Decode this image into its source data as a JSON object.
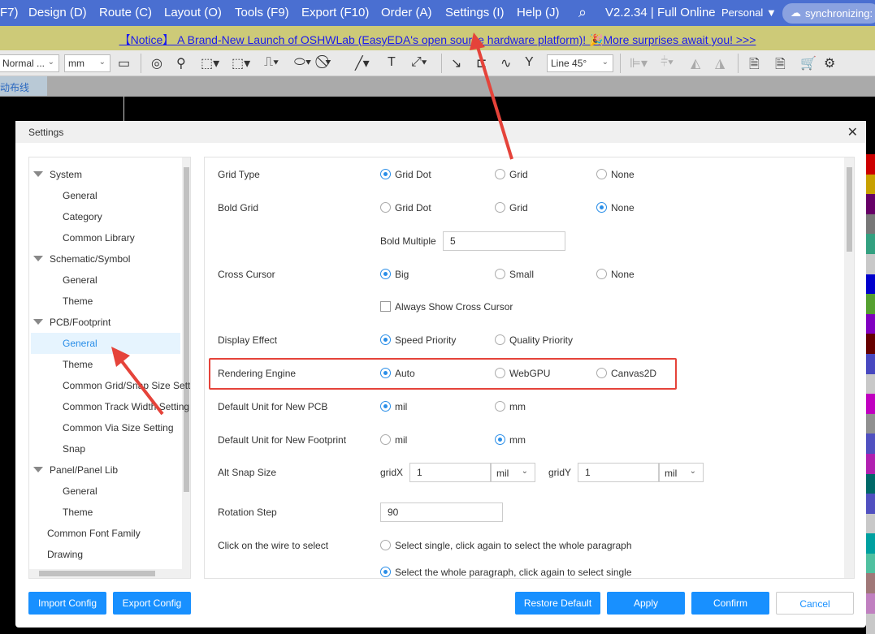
{
  "topbar": {
    "menus": [
      "F7)",
      "Design (D)",
      "Route (C)",
      "Layout (O)",
      "Tools (F9)",
      "Export (F10)",
      "Order (A)",
      "Settings (I)",
      "Help (J)"
    ],
    "version": "V2.2.34 | Full Online",
    "account": "Personal",
    "sync": "synchronizing:"
  },
  "notice": {
    "text": "【Notice】 A Brand-New Launch of OSHWLab (EasyEDA's open source hardware platform)! 🎉More surprises await you! >>>"
  },
  "toolbar": {
    "mode": "Normal ...",
    "unit": "mm",
    "route_mode": "Line 45°"
  },
  "tabs": {
    "active": "动布线"
  },
  "layer_colors": [
    "#cc0000",
    "#c8a000",
    "#660066",
    "#777777",
    "#33a080",
    "#c8c8c8",
    "#0000cc",
    "#55a030",
    "#8000c0",
    "#660000",
    "#4848c0",
    "#c8c8c8",
    "#c000c0",
    "#909090",
    "#5050c0",
    "#b020b0",
    "#006868",
    "#5050c0",
    "#c8c8c8",
    "#00a0a0",
    "#50c0a0",
    "#a07878",
    "#c080c0",
    "#c8c8c8"
  ],
  "dialog": {
    "title": "Settings",
    "tree": [
      {
        "label": "System",
        "level": 0,
        "expanded": true
      },
      {
        "label": "General",
        "level": 1
      },
      {
        "label": "Category",
        "level": 1
      },
      {
        "label": "Common Library",
        "level": 1
      },
      {
        "label": "Schematic/Symbol",
        "level": 0,
        "expanded": true
      },
      {
        "label": "General",
        "level": 1
      },
      {
        "label": "Theme",
        "level": 1
      },
      {
        "label": "PCB/Footprint",
        "level": 0,
        "expanded": true
      },
      {
        "label": "General",
        "level": 1,
        "selected": true
      },
      {
        "label": "Theme",
        "level": 1
      },
      {
        "label": "Common Grid/Snap Size Setting",
        "level": 1
      },
      {
        "label": "Common Track Width Setting",
        "level": 1
      },
      {
        "label": "Common Via Size Setting",
        "level": 1
      },
      {
        "label": "Snap",
        "level": 1
      },
      {
        "label": "Panel/Panel Lib",
        "level": 0,
        "expanded": true
      },
      {
        "label": "General",
        "level": 1
      },
      {
        "label": "Theme",
        "level": 1
      },
      {
        "label": "Common Font Family",
        "level": 0
      },
      {
        "label": "Drawing",
        "level": 0
      }
    ],
    "settings": {
      "grid_type": {
        "label": "Grid Type",
        "options": [
          "Grid Dot",
          "Grid",
          "None"
        ],
        "selected": "Grid Dot"
      },
      "bold_grid": {
        "label": "Bold Grid",
        "options": [
          "Grid Dot",
          "Grid",
          "None"
        ],
        "selected": "None",
        "multiple_label": "Bold Multiple",
        "multiple_value": "5"
      },
      "cross_cursor": {
        "label": "Cross Cursor",
        "options": [
          "Big",
          "Small",
          "None"
        ],
        "selected": "Big",
        "always_show": "Always Show Cross Cursor",
        "always_show_checked": false
      },
      "display_effect": {
        "label": "Display Effect",
        "options": [
          "Speed Priority",
          "Quality Priority"
        ],
        "selected": "Speed Priority"
      },
      "rendering_engine": {
        "label": "Rendering Engine",
        "options": [
          "Auto",
          "WebGPU",
          "Canvas2D"
        ],
        "selected": "Auto"
      },
      "unit_pcb": {
        "label": "Default Unit for New PCB",
        "options": [
          "mil",
          "mm"
        ],
        "selected": "mil"
      },
      "unit_footprint": {
        "label": "Default Unit for New Footprint",
        "options": [
          "mil",
          "mm"
        ],
        "selected": "mm"
      },
      "alt_snap": {
        "label": "Alt Snap Size",
        "gridx_label": "gridX",
        "gridx": "1",
        "gridx_unit": "mil",
        "gridy_label": "gridY",
        "gridy": "1",
        "gridy_unit": "mil"
      },
      "rotation": {
        "label": "Rotation Step",
        "value": "90"
      },
      "wire_select": {
        "label": "Click on the wire to select",
        "options": [
          "Select single, click again to select the whole paragraph",
          "Select the whole paragraph, click again to select single"
        ],
        "selected": "Select the whole paragraph, click again to select single"
      }
    },
    "buttons": {
      "import": "Import Config",
      "export": "Export Config",
      "restore": "Restore Default",
      "apply": "Apply",
      "confirm": "Confirm",
      "cancel": "Cancel"
    }
  },
  "accent": "#1890ff",
  "highlight": "#e5433a"
}
